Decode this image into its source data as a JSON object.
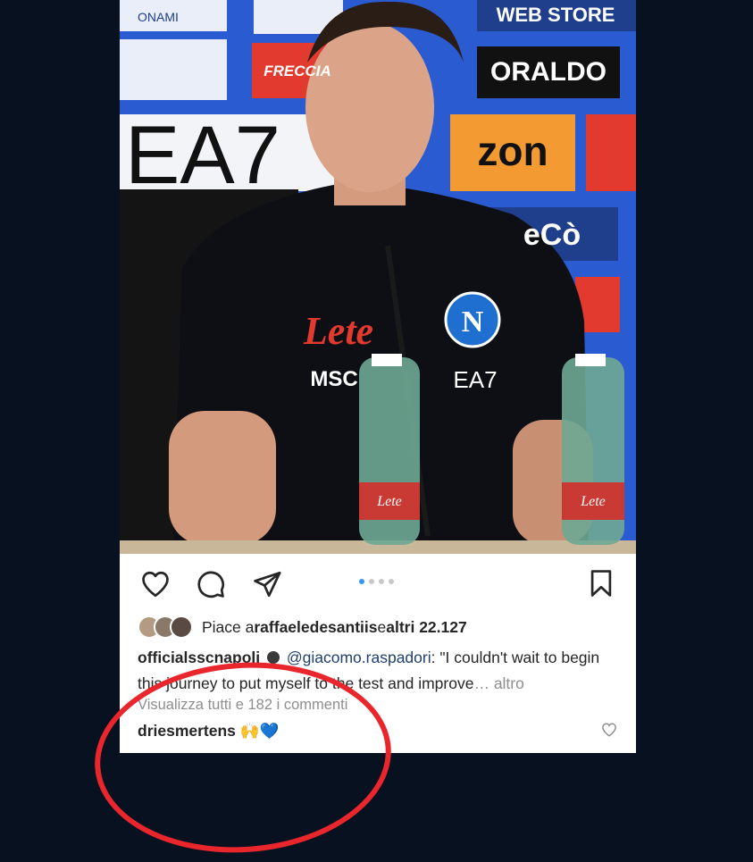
{
  "photo": {
    "sponsors": [
      "ONAMI",
      "FRECCIA",
      "WEB STORE",
      "ORALDO",
      "EA7",
      "zon",
      "eCò"
    ],
    "shirt_sponsor": "Lete",
    "shirt_secondary": "MSC",
    "shirt_brand": "EA7",
    "crest_letter": "N",
    "bottle_label": "Lete"
  },
  "actions": {
    "like_icon": "heart-icon",
    "comment_icon": "comment-icon",
    "share_icon": "send-icon",
    "save_icon": "bookmark-icon",
    "carousel_count": 4,
    "carousel_active": 0
  },
  "likes": {
    "prefix": "Piace a ",
    "user": "raffaeledesantiis",
    "middle": " e ",
    "count": "altri 22.127"
  },
  "caption": {
    "user": "officialsscnapoli",
    "mention": "@giacomo.raspadori",
    "text": ": \"I couldn't wait to begin this journey to put myself to the test and improve",
    "more": "… altro"
  },
  "comments": {
    "view_all": "Visualizza tutti e 182 i commenti"
  },
  "comment": {
    "user": "driesmertens",
    "text": " 🙌💙"
  },
  "colors": {
    "background": "#07111f",
    "annotation": "#e8262c",
    "link": "#1f3f6e"
  }
}
